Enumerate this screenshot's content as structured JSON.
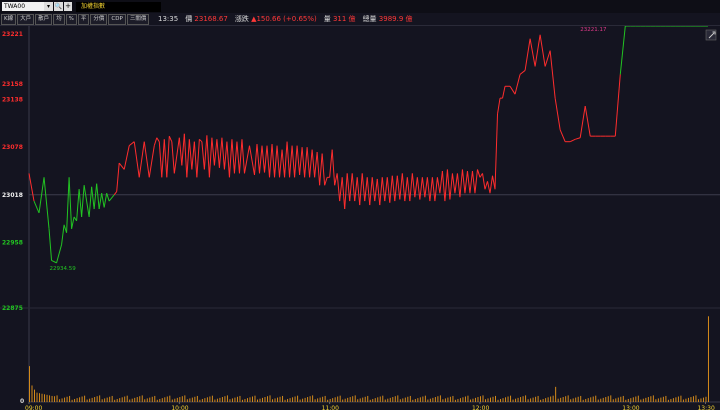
{
  "header": {
    "symbol": "TWA00",
    "symbol_dropdown": "▾",
    "search_icon": "search-icon",
    "add_label": "+",
    "name": "加權指數"
  },
  "toolbar": {
    "buttons": [
      "K線",
      "大戶",
      "散戶",
      "均",
      "%",
      "平",
      "分價",
      "CDP",
      "三關價"
    ]
  },
  "quote": {
    "time": "13:35",
    "price_label": "價",
    "price": "23168.67",
    "change_label": "漲跌",
    "change": "▲150.66 (+0.65%)",
    "volume_label": "量",
    "volume": "311 億",
    "total_label": "總量",
    "total": "3989.9 億"
  },
  "colors": {
    "background": "#141420",
    "up": "#ff2d2d",
    "down": "#22c422",
    "neutral": "#f2f2f2",
    "volume": "#d48a1a",
    "time_axis": "#f0d030",
    "grid": "#2a2a38"
  },
  "chart_data": {
    "type": "line",
    "title": "",
    "reference_value": 23018,
    "ylim": [
      22875,
      23221
    ],
    "y_ticks": [
      {
        "label": "23221",
        "value": 23221,
        "color": "up"
      },
      {
        "label": "23158",
        "value": 23158,
        "color": "up"
      },
      {
        "label": "23138",
        "value": 23138,
        "color": "up"
      },
      {
        "label": "23078",
        "value": 23078,
        "color": "up"
      },
      {
        "label": "23018",
        "value": 23018,
        "color": "neutral"
      },
      {
        "label": "22958",
        "value": 22958,
        "color": "down"
      },
      {
        "label": "22875",
        "value": 22875,
        "color": "down"
      }
    ],
    "x_ticks": [
      {
        "label": "09:00",
        "minute": 0
      },
      {
        "label": "10:00",
        "minute": 60
      },
      {
        "label": "11:00",
        "minute": 120
      },
      {
        "label": "12:00",
        "minute": 180
      },
      {
        "label": "13:00",
        "minute": 240
      },
      {
        "label": "13:30",
        "minute": 270
      }
    ],
    "x_range_minutes": [
      0,
      275
    ],
    "annotations": [
      {
        "label": "23221.17",
        "minute": 224,
        "value": 23221.17,
        "color": "up"
      },
      {
        "label": "22934.59",
        "minute": 9,
        "value": 22934.59,
        "color": "down"
      }
    ],
    "series": [
      {
        "minutes": [
          0,
          2,
          4,
          6,
          8,
          9,
          11,
          13,
          14,
          15,
          16,
          17,
          18,
          19,
          20,
          21,
          22,
          24,
          25,
          26,
          27,
          28,
          29,
          30,
          31,
          32,
          34,
          35,
          36,
          38,
          40,
          42,
          44,
          46,
          48,
          50,
          51,
          52,
          53,
          54,
          55,
          56,
          57,
          58,
          60,
          61,
          62,
          63,
          64,
          65,
          66,
          67,
          68,
          69,
          70,
          71,
          72,
          73,
          74,
          75,
          76,
          77,
          78,
          79,
          80,
          81,
          82,
          83,
          84,
          85,
          86,
          88,
          90,
          91,
          92,
          93,
          94,
          95,
          96,
          97,
          98,
          99,
          100,
          101,
          102,
          103,
          104,
          105,
          106,
          107,
          108,
          109,
          110,
          111,
          112,
          113,
          114,
          115,
          116,
          117,
          118,
          119,
          120,
          121,
          122,
          123,
          124,
          125,
          126,
          127,
          128,
          129,
          130,
          131,
          132,
          133,
          134,
          135,
          136,
          137,
          138,
          139,
          140,
          141,
          142,
          143,
          144,
          145,
          146,
          147,
          148,
          149,
          150,
          151,
          152,
          153,
          154,
          155,
          156,
          157,
          158,
          159,
          160,
          161,
          162,
          163,
          164,
          165,
          166,
          167,
          168,
          169,
          170,
          171,
          172,
          173,
          174,
          175,
          176,
          177,
          178,
          179,
          180,
          181,
          182,
          183,
          184,
          185,
          186,
          187,
          188,
          189,
          190,
          192,
          194,
          196,
          198,
          200,
          202,
          204,
          206,
          208,
          210,
          212,
          214,
          216,
          218,
          220,
          222,
          224,
          226,
          228,
          230,
          232,
          234,
          236,
          238,
          240,
          242,
          244,
          246,
          248,
          250,
          252,
          254,
          256,
          258,
          260,
          262,
          264,
          266,
          268,
          270,
          271
        ],
        "values": [
          23045,
          23010,
          22995,
          23040,
          22975,
          22935,
          22932,
          22955,
          22980,
          22970,
          23040,
          22975,
          22990,
          22985,
          23025,
          22990,
          23030,
          22990,
          23028,
          23000,
          23032,
          23000,
          23020,
          23002,
          23020,
          23010,
          23018,
          23022,
          23058,
          23050,
          23080,
          23085,
          23040,
          23085,
          23040,
          23080,
          23090,
          23085,
          23040,
          23088,
          23040,
          23092,
          23085,
          23045,
          23090,
          23055,
          23095,
          23040,
          23088,
          23050,
          23085,
          23040,
          23088,
          23085,
          23050,
          23093,
          23040,
          23090,
          23055,
          23088,
          23052,
          23090,
          23050,
          23085,
          23040,
          23088,
          23045,
          23085,
          23045,
          23088,
          23045,
          23080,
          23043,
          23082,
          23045,
          23080,
          23046,
          23080,
          23040,
          23082,
          23040,
          23080,
          23040,
          23075,
          23040,
          23085,
          23040,
          23080,
          23040,
          23080,
          23043,
          23078,
          23040,
          23078,
          23040,
          23075,
          23040,
          23072,
          23030,
          23070,
          23030,
          23040,
          23040,
          23075,
          23030,
          23045,
          23010,
          23040,
          23000,
          23045,
          23010,
          23045,
          23010,
          23040,
          23005,
          23045,
          23010,
          23040,
          23005,
          23040,
          23010,
          23038,
          23005,
          23040,
          23010,
          23040,
          23008,
          23042,
          23010,
          23042,
          23012,
          23045,
          23010,
          23040,
          23010,
          23045,
          23015,
          23040,
          23012,
          23040,
          23015,
          23040,
          23010,
          23040,
          23010,
          23040,
          23020,
          23048,
          23010,
          23050,
          23012,
          23045,
          23020,
          23045,
          23015,
          23050,
          23020,
          23048,
          23020,
          23048,
          23020,
          23050,
          23040,
          23045,
          23025,
          23035,
          23020,
          23042,
          23025,
          23120,
          23140,
          23140,
          23155,
          23155,
          23145,
          23170,
          23175,
          23215,
          23180,
          23220,
          23180,
          23200,
          23140,
          23100,
          23085,
          23085,
          23088,
          23090,
          23130,
          23092,
          23092,
          23092,
          23092,
          23092,
          23092,
          23170
        ]
      }
    ],
    "volume": {
      "ylim": [
        0,
        312
      ],
      "note_minutes": "one bar per minute from 0 to 271",
      "values_sample": [
        {
          "minute": 0,
          "value": 130
        },
        {
          "minute": 1,
          "value": 60
        },
        {
          "minute": 2,
          "value": 45
        },
        {
          "minute": 210,
          "value": 55
        },
        {
          "minute": 271,
          "value": 311
        }
      ]
    }
  }
}
